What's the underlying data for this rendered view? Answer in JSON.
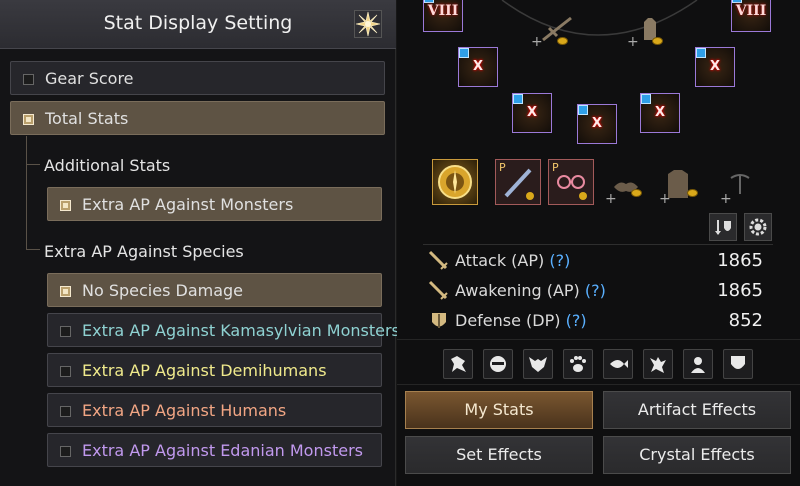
{
  "stat_panel": {
    "title": "Stat Display Setting",
    "options": {
      "gear_score": {
        "label": "Gear Score",
        "checked": false
      },
      "total_stats": {
        "label": "Total Stats",
        "checked": true
      }
    },
    "additional_stats": {
      "title": "Additional Stats",
      "items": [
        {
          "label": "Extra AP Against Monsters",
          "checked": true
        }
      ]
    },
    "species": {
      "title": "Extra AP Against Species",
      "items": [
        {
          "label": "No Species Damage",
          "checked": true,
          "color": "#e4e4e4"
        },
        {
          "label": "Extra AP Against Kamasylvian Monsters",
          "checked": false,
          "color": "#8fd2d2"
        },
        {
          "label": "Extra AP Against Demihumans",
          "checked": false,
          "color": "#f0ea8c"
        },
        {
          "label": "Extra AP Against Humans",
          "checked": false,
          "color": "#f2a684"
        },
        {
          "label": "Extra AP Against Edanian Monsters",
          "checked": false,
          "color": "#c199ee"
        }
      ]
    }
  },
  "equipment": {
    "enhance_labels": {
      "top_left": "VIII",
      "top_right": "VIII",
      "accessory": "X"
    },
    "badges": {
      "pearl_a": "P",
      "pearl_b": "P"
    }
  },
  "stats": {
    "attack": {
      "label": "Attack (AP)",
      "help": "(?)",
      "value": "1865",
      "icon": "sword-icon"
    },
    "awakening": {
      "label": "Awakening (AP)",
      "help": "(?)",
      "value": "1865",
      "icon": "sword-icon"
    },
    "defense": {
      "label": "Defense (DP)",
      "help": "(?)",
      "value": "852",
      "icon": "shield-icon"
    }
  },
  "species_filter_icons": [
    "kamasylvian-icon",
    "demihuman-mask-icon",
    "bat-demon-icon",
    "paw-icon",
    "fish-icon",
    "goblin-icon",
    "human-icon",
    "shield-icon"
  ],
  "buttons": {
    "my_stats": "My Stats",
    "artifact_effects": "Artifact Effects",
    "set_effects": "Set Effects",
    "crystal_effects": "Crystal Effects"
  },
  "colors": {
    "accent_gold": "#a6804f",
    "help": "#5ab0ff",
    "slot_border": "#9b79d8"
  }
}
